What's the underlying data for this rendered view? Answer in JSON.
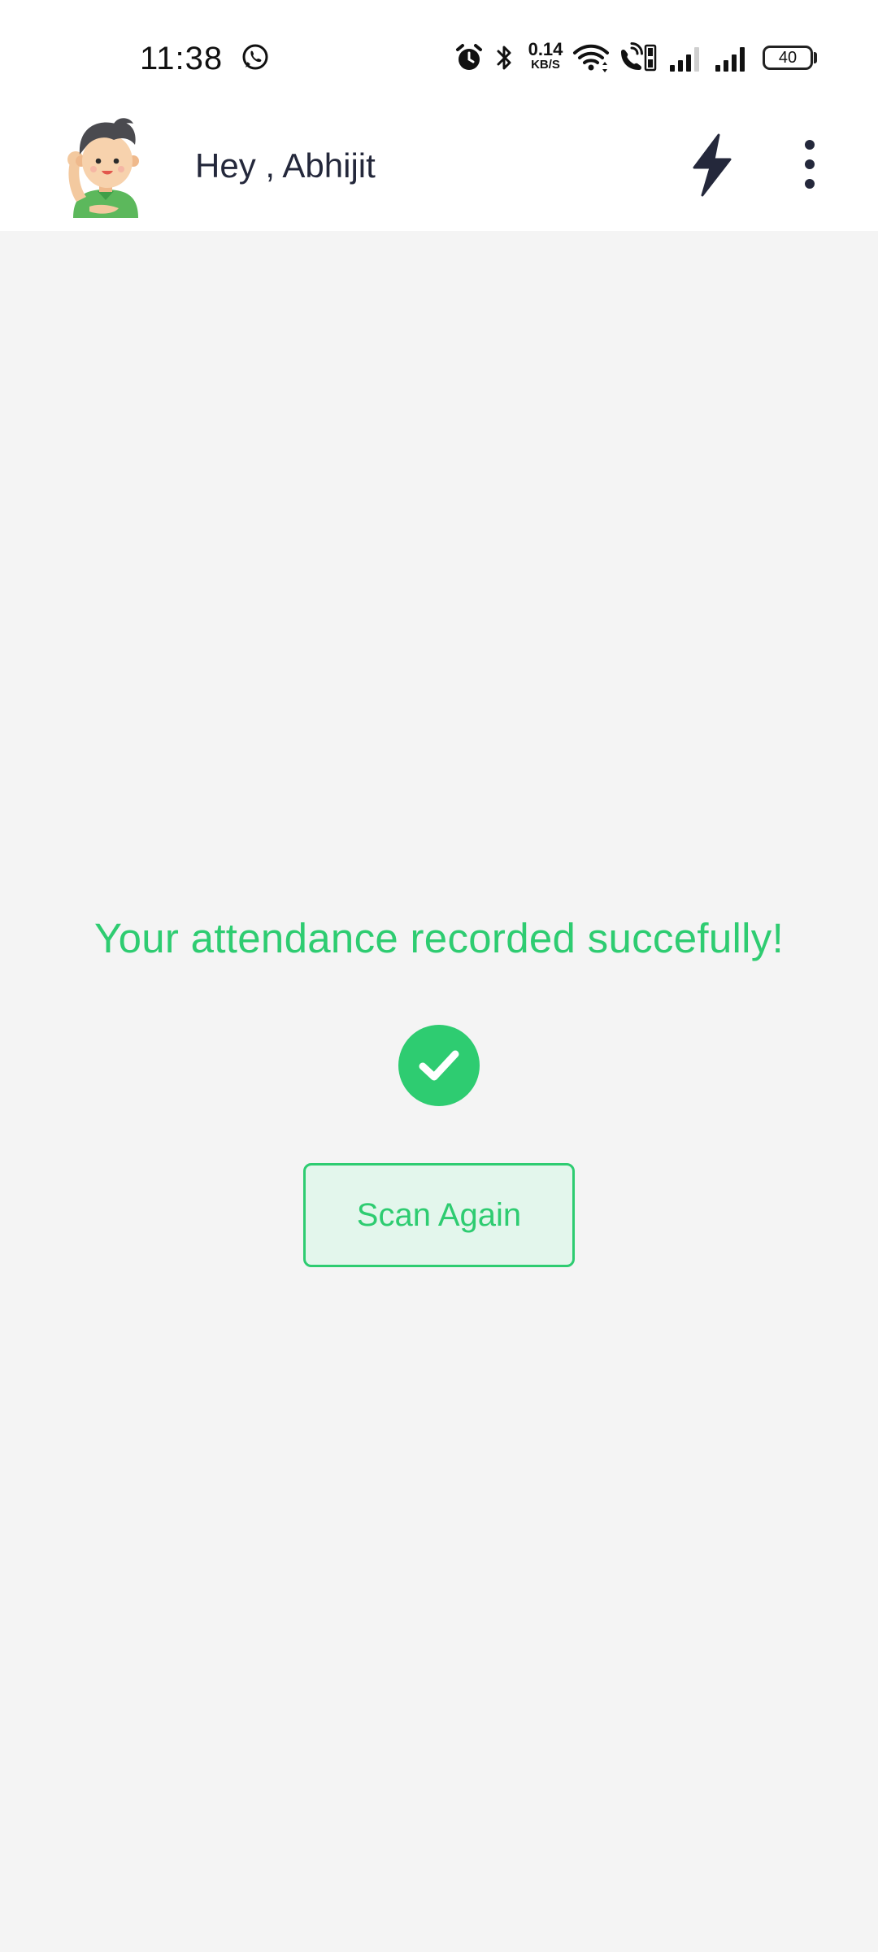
{
  "status_bar": {
    "time": "11:38",
    "net_speed_value": "0.14",
    "net_speed_unit": "KB/S",
    "battery": "40",
    "icons": [
      "whatsapp-icon",
      "alarm-icon",
      "bluetooth-icon",
      "wifi-icon",
      "volte-call-icon",
      "signal-icon-sim1",
      "signal-icon-sim2"
    ]
  },
  "header": {
    "greeting": "Hey , Abhijit",
    "icons": [
      "avatar",
      "lightning-icon",
      "more-options-icon"
    ]
  },
  "main": {
    "message": "Your attendance recorded succefully!",
    "scan_button_label": "Scan Again"
  },
  "colors": {
    "accent": "#2ecc71",
    "accent_light": "#e3f6ec",
    "text_dark": "#24283b",
    "background": "#f4f4f4",
    "header_bg": "#ffffff"
  }
}
